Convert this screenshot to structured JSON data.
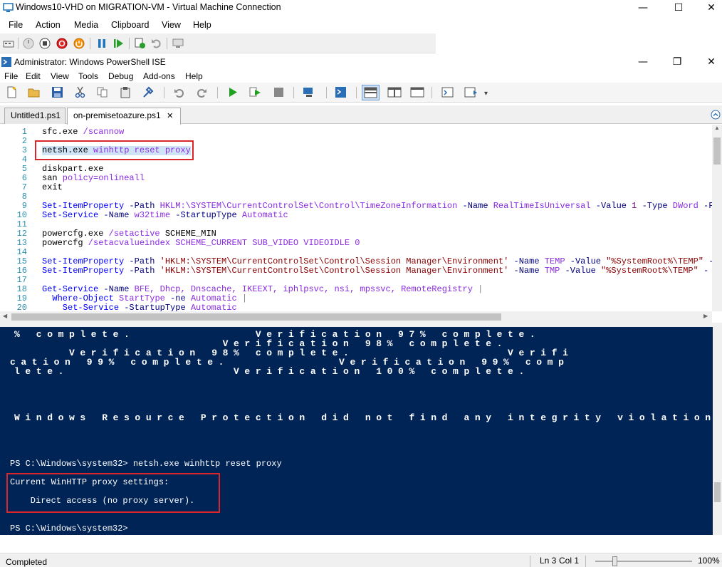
{
  "vm_window": {
    "title": "Windows10-VHD on MIGRATION-VM - Virtual Machine Connection",
    "minimize": "—",
    "maximize": "☐",
    "close": "✕",
    "menu": [
      "File",
      "Action",
      "Media",
      "Clipboard",
      "View",
      "Help"
    ]
  },
  "ise_window": {
    "title": "Administrator: Windows PowerShell ISE",
    "minimize": "—",
    "restore": "❐",
    "close": "✕",
    "menu": [
      "File",
      "Edit",
      "View",
      "Tools",
      "Debug",
      "Add-ons",
      "Help"
    ],
    "tabs": [
      {
        "label": "Untitled1.ps1",
        "active": false
      },
      {
        "label": "on-premisetoazure.ps1",
        "active": true,
        "close": "✕"
      }
    ]
  },
  "editor": {
    "line_numbers": [
      "1",
      "2",
      "3",
      "4",
      "5",
      "6",
      "7",
      "8",
      "9",
      "10",
      "11",
      "12",
      "13",
      "14",
      "15",
      "16",
      "17",
      "18",
      "19",
      "20"
    ],
    "lines": {
      "l1a": "sfc.exe",
      "l1b": " /scannow",
      "l3a": "netsh.exe",
      "l3b": " winhttp reset proxy",
      "l5": "diskpart.exe",
      "l6a": "san",
      "l6b": " policy=onlineall",
      "l7": "exit",
      "l9a": "Set-ItemProperty",
      "l9b": " -Path",
      "l9c": " HKLM:\\SYSTEM\\CurrentControlSet\\Control\\TimeZoneInformation",
      "l9d": " -Name",
      "l9e": " RealTimeIsUniversal",
      "l9f": " -Value",
      "l9g": " 1",
      "l9h": " -Type",
      "l9i": " DWord",
      "l9j": " -F",
      "l10a": "Set-Service",
      "l10b": " -Name",
      "l10c": " w32time",
      "l10d": " -StartupType",
      "l10e": " Automatic",
      "l12a": "powercfg.exe",
      "l12b": " /setactive",
      "l12c": " SCHEME_MIN",
      "l13a": "powercfg",
      "l13b": " /setacvalueindex SCHEME_CURRENT SUB_VIDEO VIDEOIDLE 0",
      "l15a": "Set-ItemProperty",
      "l15b": " -Path",
      "l15c": " 'HKLM:\\SYSTEM\\CurrentControlSet\\Control\\Session Manager\\Environment'",
      "l15d": " -Name",
      "l15e": " TEMP",
      "l15f": " -Value",
      "l15g": " \"%SystemRoot%\\TEMP\"",
      "l15h": " -",
      "l16a": "Set-ItemProperty",
      "l16b": " -Path",
      "l16c": " 'HKLM:\\SYSTEM\\CurrentControlSet\\Control\\Session Manager\\Environment'",
      "l16d": " -Name",
      "l16e": " TMP",
      "l16f": " -Value",
      "l16g": " \"%SystemRoot%\\TEMP\"",
      "l16h": " -",
      "l18a": "Get-Service",
      "l18b": " -Name",
      "l18c": " BFE, Dhcp, Dnscache, IKEEXT, iphlpsvc, nsi, mpssvc, RemoteRegistry",
      "l18d": " |",
      "l19a": "  Where-Object",
      "l19b": " StartType",
      "l19c": " -ne",
      "l19d": " Automatic",
      "l19e": " |",
      "l20a": "    Set-Service",
      "l20b": " -StartupType",
      "l20c": " Automatic"
    }
  },
  "console": {
    "r1": "% complete.           Verification 97% complete.",
    "r2": "                   Verification 98% complete.",
    "r3": "     Verification 98% complete.              Verifi",
    "r4": "cation 99% complete.          Verification 99% comp",
    "r5": "lete.               Verification 100% complete.",
    "r6": "Windows Resource Protection did not find any integrity violations.",
    "prompt1": "PS C:\\Windows\\system32> netsh.exe winhttp reset proxy",
    "out1": "Current WinHTTP proxy settings:",
    "out2": "    Direct access (no proxy server).",
    "prompt2": "PS C:\\Windows\\system32>"
  },
  "status": {
    "text": "Completed",
    "ln_label": "Ln 3",
    "col_label": "Col 1",
    "zoom": "100%"
  }
}
